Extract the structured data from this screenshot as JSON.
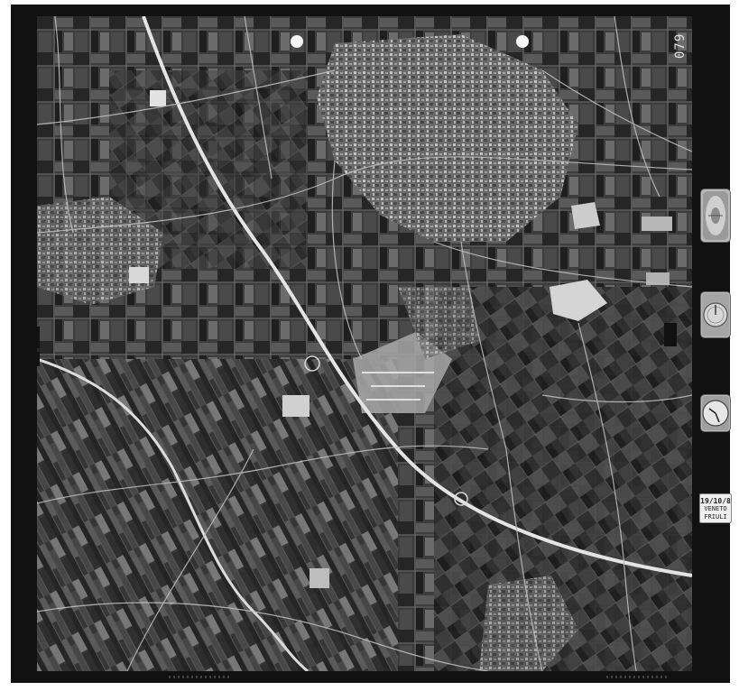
{
  "photo": {
    "frame_number": "079",
    "data_card": {
      "date": "19/10/8",
      "line1": "VENETO",
      "line2": "FRIULI"
    },
    "instruments": [
      "level-bubble-icon",
      "altimeter-icon",
      "clock-icon"
    ],
    "colors": {
      "border": "#111111",
      "fields_dark": "#2b2b2b",
      "fields_light": "#8c8c8c",
      "roads": "#d9d9d9"
    }
  }
}
